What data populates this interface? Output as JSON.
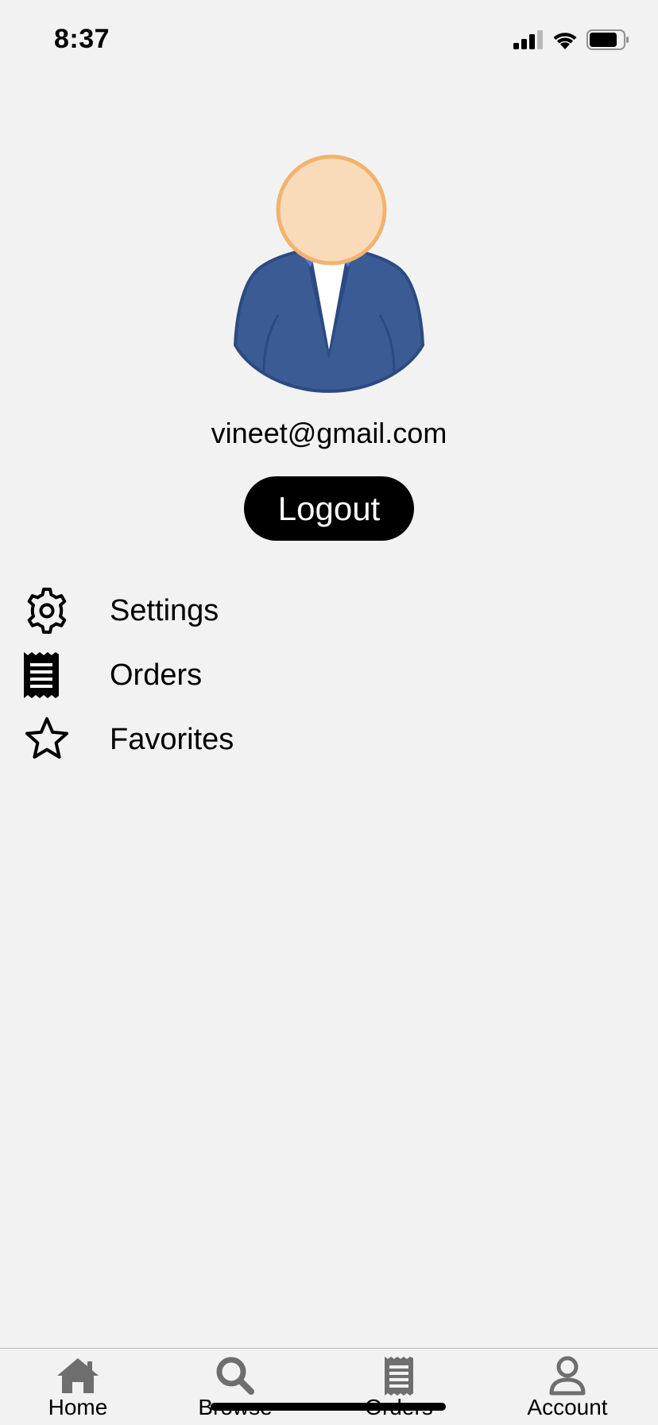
{
  "status_bar": {
    "time": "8:37"
  },
  "profile": {
    "email": "vineet@gmail.com",
    "logout_label": "Logout"
  },
  "menu": {
    "items": [
      {
        "label": "Settings",
        "icon": "gear-icon"
      },
      {
        "label": "Orders",
        "icon": "receipt-icon"
      },
      {
        "label": "Favorites",
        "icon": "star-icon"
      }
    ]
  },
  "tab_bar": {
    "tabs": [
      {
        "label": "Home",
        "icon": "home-icon"
      },
      {
        "label": "Browse",
        "icon": "search-icon"
      },
      {
        "label": "Orders",
        "icon": "receipt-icon"
      },
      {
        "label": "Account",
        "icon": "user-icon"
      }
    ]
  },
  "colors": {
    "background": "#f2f2f2",
    "button": "#000000",
    "tab_icon": "#6e6e6e",
    "avatar_suit": "#3b5b94",
    "avatar_face": "#fadbb9"
  }
}
